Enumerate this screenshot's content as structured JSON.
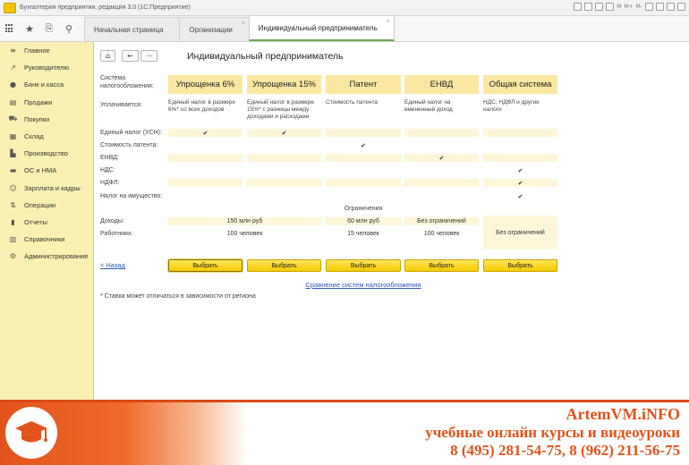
{
  "titlebar": {
    "title": "Бухгалтерия предприятия, редакция 3.0  (1С:Предприятие)",
    "indicators": [
      "M",
      "M+",
      "M-"
    ]
  },
  "tabs": [
    {
      "label": "Начальная страница"
    },
    {
      "label": "Организации",
      "close": "×"
    },
    {
      "label": "Индивидуальный предприниматель",
      "close": "×"
    }
  ],
  "sidebar": {
    "items": [
      {
        "label": "Главное",
        "icon": "menu-icon"
      },
      {
        "label": "Руководителю",
        "icon": "trend-icon"
      },
      {
        "label": "Банк и касса",
        "icon": "coin-icon"
      },
      {
        "label": "Продажи",
        "icon": "sales-icon"
      },
      {
        "label": "Покупки",
        "icon": "cart-icon"
      },
      {
        "label": "Склад",
        "icon": "warehouse-icon"
      },
      {
        "label": "Производство",
        "icon": "factory-icon"
      },
      {
        "label": "ОС и НМА",
        "icon": "car-icon"
      },
      {
        "label": "Зарплата и кадры",
        "icon": "person-icon"
      },
      {
        "label": "Операции",
        "icon": "operations-icon"
      },
      {
        "label": "Отчеты",
        "icon": "chart-icon"
      },
      {
        "label": "Справочники",
        "icon": "book-icon"
      },
      {
        "label": "Администрирование",
        "icon": "gear-icon"
      }
    ]
  },
  "nav": {
    "home": "⌂",
    "back": "←",
    "forward": "→"
  },
  "page_title": "Индивидуальный предприниматель",
  "labels": {
    "system": "Система налогообложения:",
    "pays": "Уплачивается:",
    "usn": "Единый налог (УСН):",
    "patent_cost": "Стоимость патента:",
    "envd": "ЕНВД:",
    "nds": "НДС:",
    "ndfl": "НДФЛ:",
    "property": "Налог на имущество:",
    "income": "Доходы:",
    "workers": "Работники:"
  },
  "systems": [
    {
      "name": "Упрощенка 6%",
      "desc": "Единый налог в размере 6%* со всех доходов"
    },
    {
      "name": "Упрощенка 15%",
      "desc": "Единый налог в размере 15%* с разницы между доходами и расходами"
    },
    {
      "name": "Патент",
      "desc": "Стоимость патента"
    },
    {
      "name": "ЕНВД",
      "desc": "Единый налог на вмененный доход"
    },
    {
      "name": "Общая система",
      "desc": "НДС, НДФЛ и другие налоги"
    }
  ],
  "checkmark": "✔",
  "restrictions": {
    "title": "Ограничения",
    "income_usn": "150 млн руб",
    "income_patent": "60 млн руб",
    "income_envd": "Без ограничений",
    "workers_usn": "100 человек",
    "workers_patent": "15 человек",
    "workers_envd": "100 человек",
    "general": "Без ограничений"
  },
  "buttons": {
    "choose": "Выбрать",
    "back": "< Назад"
  },
  "compare_link": "Сравнение систем налогообложения",
  "footnote": "* Ставка может отличаться в зависимости от региона",
  "banner": {
    "site": "ArtemVM.iNFO",
    "subtitle": "учебные онлайн курсы и видеоуроки",
    "phones": "8 (495) 281-54-75, 8 (962) 211-56-75"
  }
}
